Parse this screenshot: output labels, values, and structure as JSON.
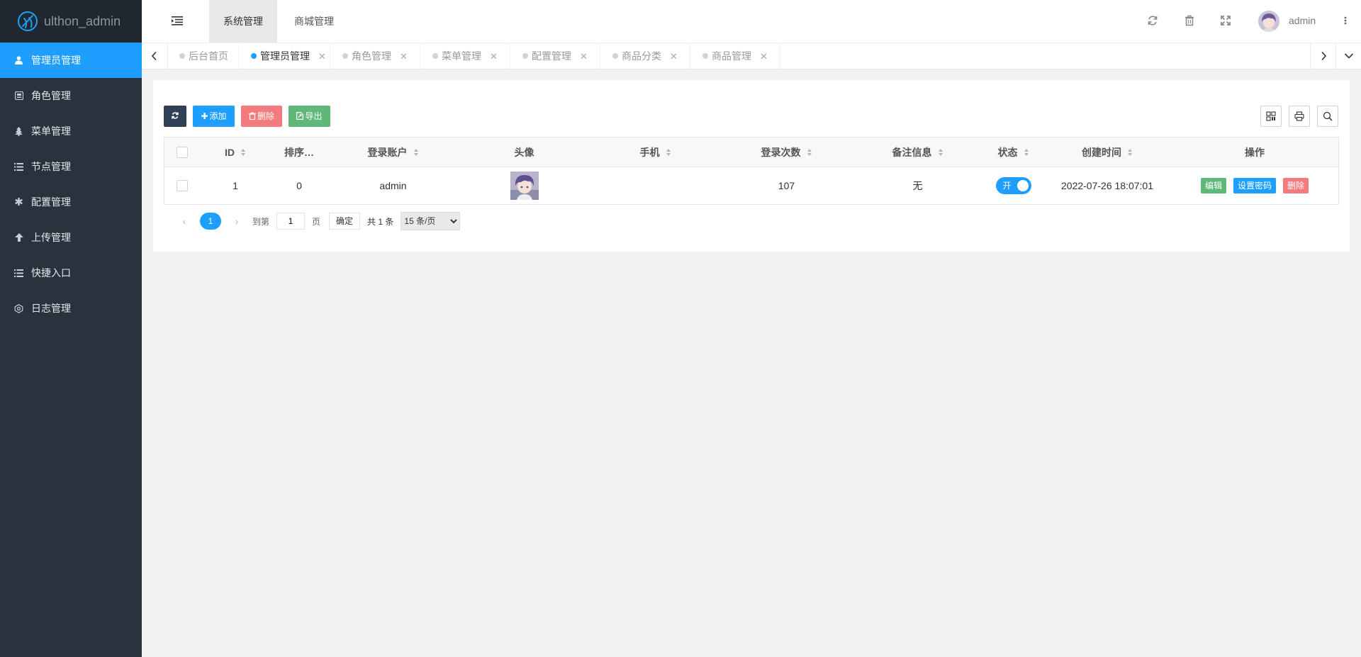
{
  "app": {
    "logo_text": "ulthon_admin"
  },
  "sidebar": {
    "items": [
      {
        "label": "管理员管理",
        "icon": "user-icon",
        "active": true
      },
      {
        "label": "角色管理",
        "icon": "role-icon"
      },
      {
        "label": "菜单管理",
        "icon": "tree-icon"
      },
      {
        "label": "节点管理",
        "icon": "list-icon"
      },
      {
        "label": "配置管理",
        "icon": "asterisk-icon"
      },
      {
        "label": "上传管理",
        "icon": "upload-arrow-icon"
      },
      {
        "label": "快捷入口",
        "icon": "list-icon"
      },
      {
        "label": "日志管理",
        "icon": "log-icon"
      }
    ]
  },
  "header": {
    "top_tabs": [
      {
        "label": "系统管理",
        "active": true
      },
      {
        "label": "商城管理"
      }
    ],
    "username": "admin"
  },
  "tabs": [
    {
      "label": "后台首页",
      "closable": false
    },
    {
      "label": "管理员管理",
      "active": true,
      "closable": true
    },
    {
      "label": "角色管理",
      "closable": true
    },
    {
      "label": "菜单管理",
      "closable": true
    },
    {
      "label": "配置管理",
      "closable": true
    },
    {
      "label": "商品分类",
      "closable": true
    },
    {
      "label": "商品管理",
      "closable": true
    }
  ],
  "toolbar": {
    "add_label": "添加",
    "delete_label": "删除",
    "export_label": "导出"
  },
  "table": {
    "columns": [
      "ID",
      "排序…",
      "登录账户",
      "头像",
      "手机",
      "登录次数",
      "备注信息",
      "状态",
      "创建时间",
      "操作"
    ],
    "rows": [
      {
        "id": "1",
        "sort": "0",
        "username": "admin",
        "phone": "",
        "login_count": "107",
        "remark": "无",
        "status_label": "开",
        "status_on": true,
        "created": "2022-07-26 18:07:01"
      }
    ],
    "actions": {
      "edit": "编辑",
      "set_password": "设置密码",
      "delete": "删除"
    }
  },
  "pagination": {
    "current": "1",
    "goto_label": "到第",
    "page_value": "1",
    "page_unit": "页",
    "confirm": "确定",
    "total": "共 1 条",
    "per_page": "15 条/页"
  },
  "colors": {
    "sidebar_bg": "#28333e",
    "accent": "#1e9fff",
    "danger": "#f37b7d",
    "success": "#5fb878",
    "dark": "#2f4056"
  }
}
